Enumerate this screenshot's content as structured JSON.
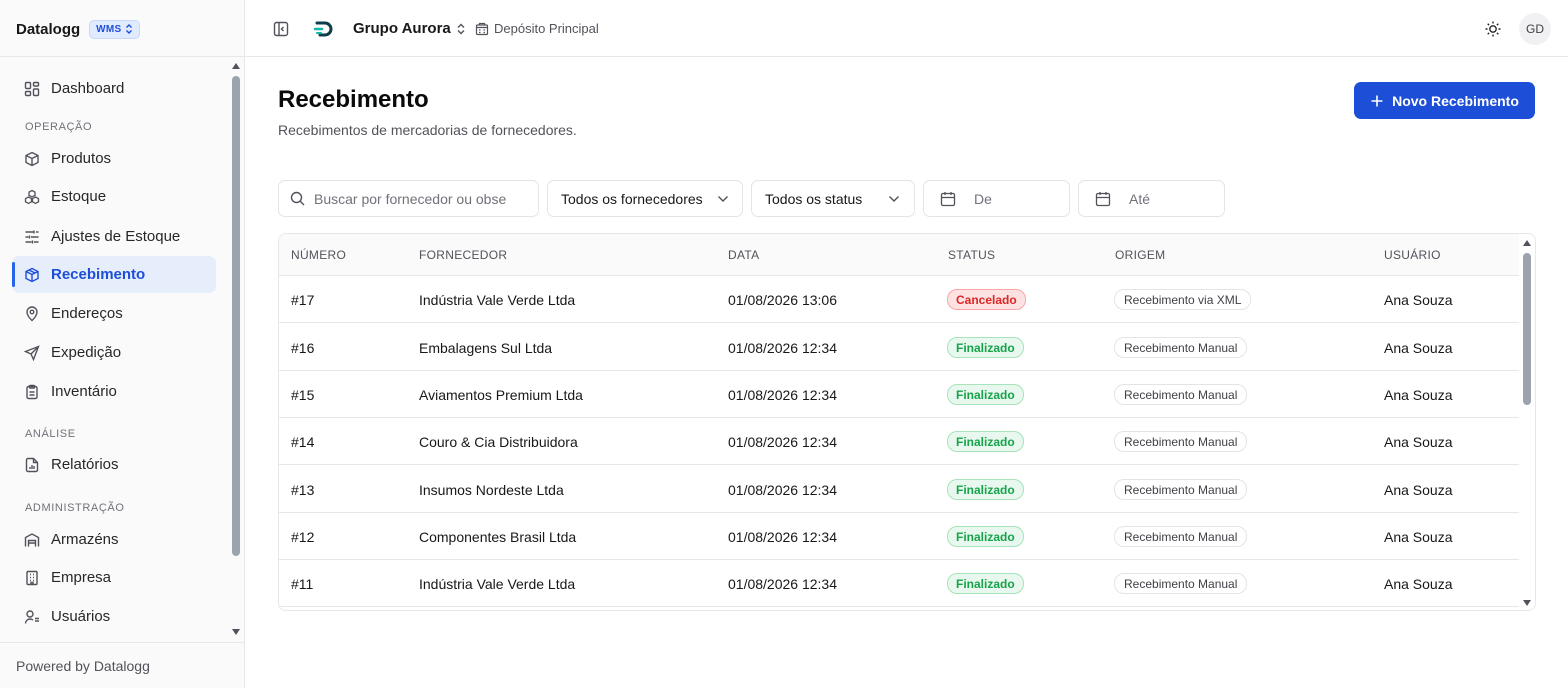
{
  "sidebar": {
    "brand": "Datalogg",
    "badge": "WMS",
    "items": [
      {
        "label": "Dashboard",
        "icon": "dashboard-icon"
      },
      {
        "section": "OPERAÇÃO"
      },
      {
        "label": "Produtos",
        "icon": "box-icon"
      },
      {
        "label": "Estoque",
        "icon": "boxes-icon"
      },
      {
        "label": "Ajustes de Estoque",
        "icon": "sliders-icon"
      },
      {
        "label": "Recebimento",
        "icon": "package-check-icon",
        "active": true
      },
      {
        "label": "Endereços",
        "icon": "map-pin-icon"
      },
      {
        "label": "Expedição",
        "icon": "send-icon"
      },
      {
        "label": "Inventário",
        "icon": "clipboard-icon"
      },
      {
        "section": "ANÁLISE"
      },
      {
        "label": "Relatórios",
        "icon": "report-icon"
      },
      {
        "section": "ADMINISTRAÇÃO"
      },
      {
        "label": "Armazéns",
        "icon": "warehouse-icon"
      },
      {
        "label": "Empresa",
        "icon": "building-icon"
      },
      {
        "label": "Usuários",
        "icon": "users-icon"
      }
    ],
    "footer": "Powered by Datalogg"
  },
  "header": {
    "org": "Grupo Aurora",
    "warehouse": "Depósito Principal",
    "avatar": "GD"
  },
  "page": {
    "title": "Recebimento",
    "subtitle": "Recebimentos de mercadorias de fornecedores.",
    "new_button": "Novo Recebimento"
  },
  "filters": {
    "search_placeholder": "Buscar por fornecedor ou obse",
    "supplier": "Todos os fornecedores",
    "status": "Todos os status",
    "from": "De",
    "to": "Até"
  },
  "table": {
    "columns": [
      "NÚMERO",
      "FORNECEDOR",
      "DATA",
      "STATUS",
      "ORIGEM",
      "USUÁRIO"
    ],
    "rows": [
      {
        "numero": "#17",
        "fornecedor": "Indústria Vale Verde Ltda",
        "data": "01/08/2026 13:06",
        "status": "Cancelado",
        "origem": "Recebimento via XML",
        "usuario": "Ana Souza"
      },
      {
        "numero": "#16",
        "fornecedor": "Embalagens Sul Ltda",
        "data": "01/08/2026 12:34",
        "status": "Finalizado",
        "origem": "Recebimento Manual",
        "usuario": "Ana Souza"
      },
      {
        "numero": "#15",
        "fornecedor": "Aviamentos Premium Ltda",
        "data": "01/08/2026 12:34",
        "status": "Finalizado",
        "origem": "Recebimento Manual",
        "usuario": "Ana Souza"
      },
      {
        "numero": "#14",
        "fornecedor": "Couro & Cia Distribuidora",
        "data": "01/08/2026 12:34",
        "status": "Finalizado",
        "origem": "Recebimento Manual",
        "usuario": "Ana Souza"
      },
      {
        "numero": "#13",
        "fornecedor": "Insumos Nordeste Ltda",
        "data": "01/08/2026 12:34",
        "status": "Finalizado",
        "origem": "Recebimento Manual",
        "usuario": "Ana Souza"
      },
      {
        "numero": "#12",
        "fornecedor": "Componentes Brasil Ltda",
        "data": "01/08/2026 12:34",
        "status": "Finalizado",
        "origem": "Recebimento Manual",
        "usuario": "Ana Souza"
      },
      {
        "numero": "#11",
        "fornecedor": "Indústria Vale Verde Ltda",
        "data": "01/08/2026 12:34",
        "status": "Finalizado",
        "origem": "Recebimento Manual",
        "usuario": "Ana Souza"
      }
    ]
  },
  "colors": {
    "accent": "#1d4ed8",
    "cancel": "#dc2626",
    "done": "#16a34a"
  }
}
